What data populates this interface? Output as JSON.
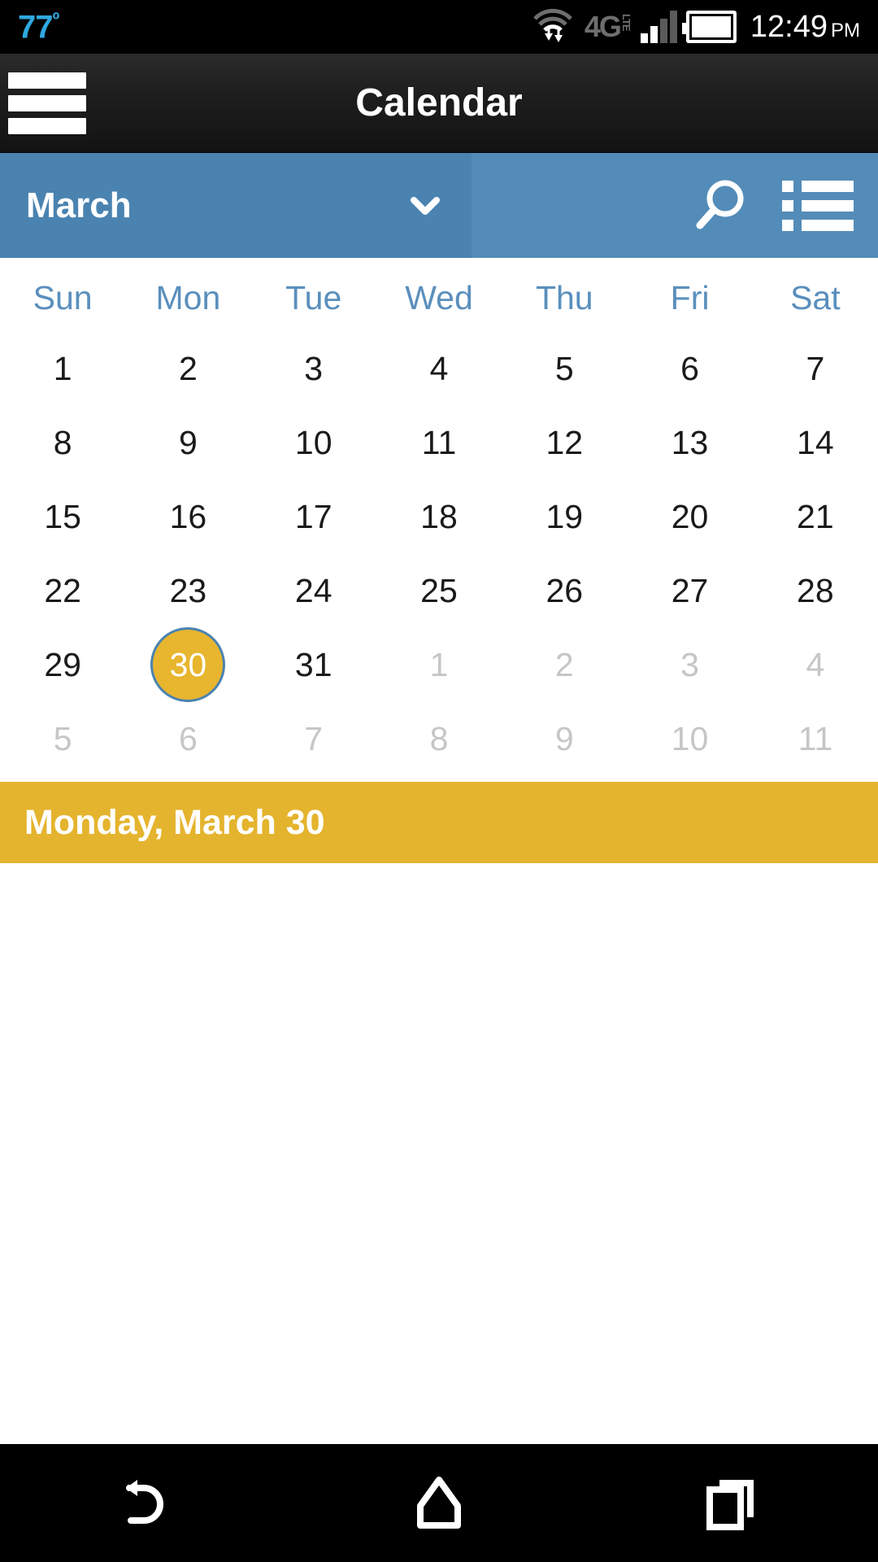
{
  "statusbar": {
    "temperature": "77",
    "degree_symbol": "º",
    "network": "4G",
    "network_sub": "LTE",
    "time": "12:49",
    "meridiem": "PM",
    "icons": [
      "wifi-transfer-icon",
      "4g-lte-icon",
      "signal-bars-icon",
      "battery-icon"
    ],
    "temp_color": "#2ea8e0"
  },
  "appbar": {
    "title": "Calendar",
    "menu_icon": "hamburger-menu-icon"
  },
  "monthbar": {
    "month": "March",
    "dropdown_icon": "chevron-down-icon",
    "search_icon": "search-icon",
    "list_icon": "list-view-icon",
    "left_color": "#4a83b0",
    "right_color": "#538cb8"
  },
  "calendar": {
    "weekdays": [
      "Sun",
      "Mon",
      "Tue",
      "Wed",
      "Thu",
      "Fri",
      "Sat"
    ],
    "weekday_color": "#5a8fbd",
    "today_bg": "#e8b52e",
    "today_ring": "#4a83b0",
    "other_month_color": "#c6c6c6",
    "weeks": [
      [
        {
          "label": "1",
          "state": "current"
        },
        {
          "label": "2",
          "state": "current"
        },
        {
          "label": "3",
          "state": "current"
        },
        {
          "label": "4",
          "state": "current"
        },
        {
          "label": "5",
          "state": "current"
        },
        {
          "label": "6",
          "state": "current"
        },
        {
          "label": "7",
          "state": "current"
        }
      ],
      [
        {
          "label": "8",
          "state": "current"
        },
        {
          "label": "9",
          "state": "current"
        },
        {
          "label": "10",
          "state": "current"
        },
        {
          "label": "11",
          "state": "current"
        },
        {
          "label": "12",
          "state": "current"
        },
        {
          "label": "13",
          "state": "current"
        },
        {
          "label": "14",
          "state": "current"
        }
      ],
      [
        {
          "label": "15",
          "state": "current"
        },
        {
          "label": "16",
          "state": "current"
        },
        {
          "label": "17",
          "state": "current"
        },
        {
          "label": "18",
          "state": "current"
        },
        {
          "label": "19",
          "state": "current"
        },
        {
          "label": "20",
          "state": "current"
        },
        {
          "label": "21",
          "state": "current"
        }
      ],
      [
        {
          "label": "22",
          "state": "current"
        },
        {
          "label": "23",
          "state": "current"
        },
        {
          "label": "24",
          "state": "current"
        },
        {
          "label": "25",
          "state": "current"
        },
        {
          "label": "26",
          "state": "current"
        },
        {
          "label": "27",
          "state": "current"
        },
        {
          "label": "28",
          "state": "current"
        }
      ],
      [
        {
          "label": "29",
          "state": "current"
        },
        {
          "label": "30",
          "state": "today"
        },
        {
          "label": "31",
          "state": "current"
        },
        {
          "label": "1",
          "state": "other"
        },
        {
          "label": "2",
          "state": "other"
        },
        {
          "label": "3",
          "state": "other"
        },
        {
          "label": "4",
          "state": "other"
        }
      ],
      [
        {
          "label": "5",
          "state": "other"
        },
        {
          "label": "6",
          "state": "other"
        },
        {
          "label": "7",
          "state": "other"
        },
        {
          "label": "8",
          "state": "other"
        },
        {
          "label": "9",
          "state": "other"
        },
        {
          "label": "10",
          "state": "other"
        },
        {
          "label": "11",
          "state": "other"
        }
      ]
    ]
  },
  "date_banner": {
    "text": "Monday, March 30",
    "bg_color": "#e5b42e"
  },
  "navbar": {
    "back_icon": "back-arrow-icon",
    "home_icon": "home-icon",
    "recents_icon": "recent-apps-icon"
  }
}
